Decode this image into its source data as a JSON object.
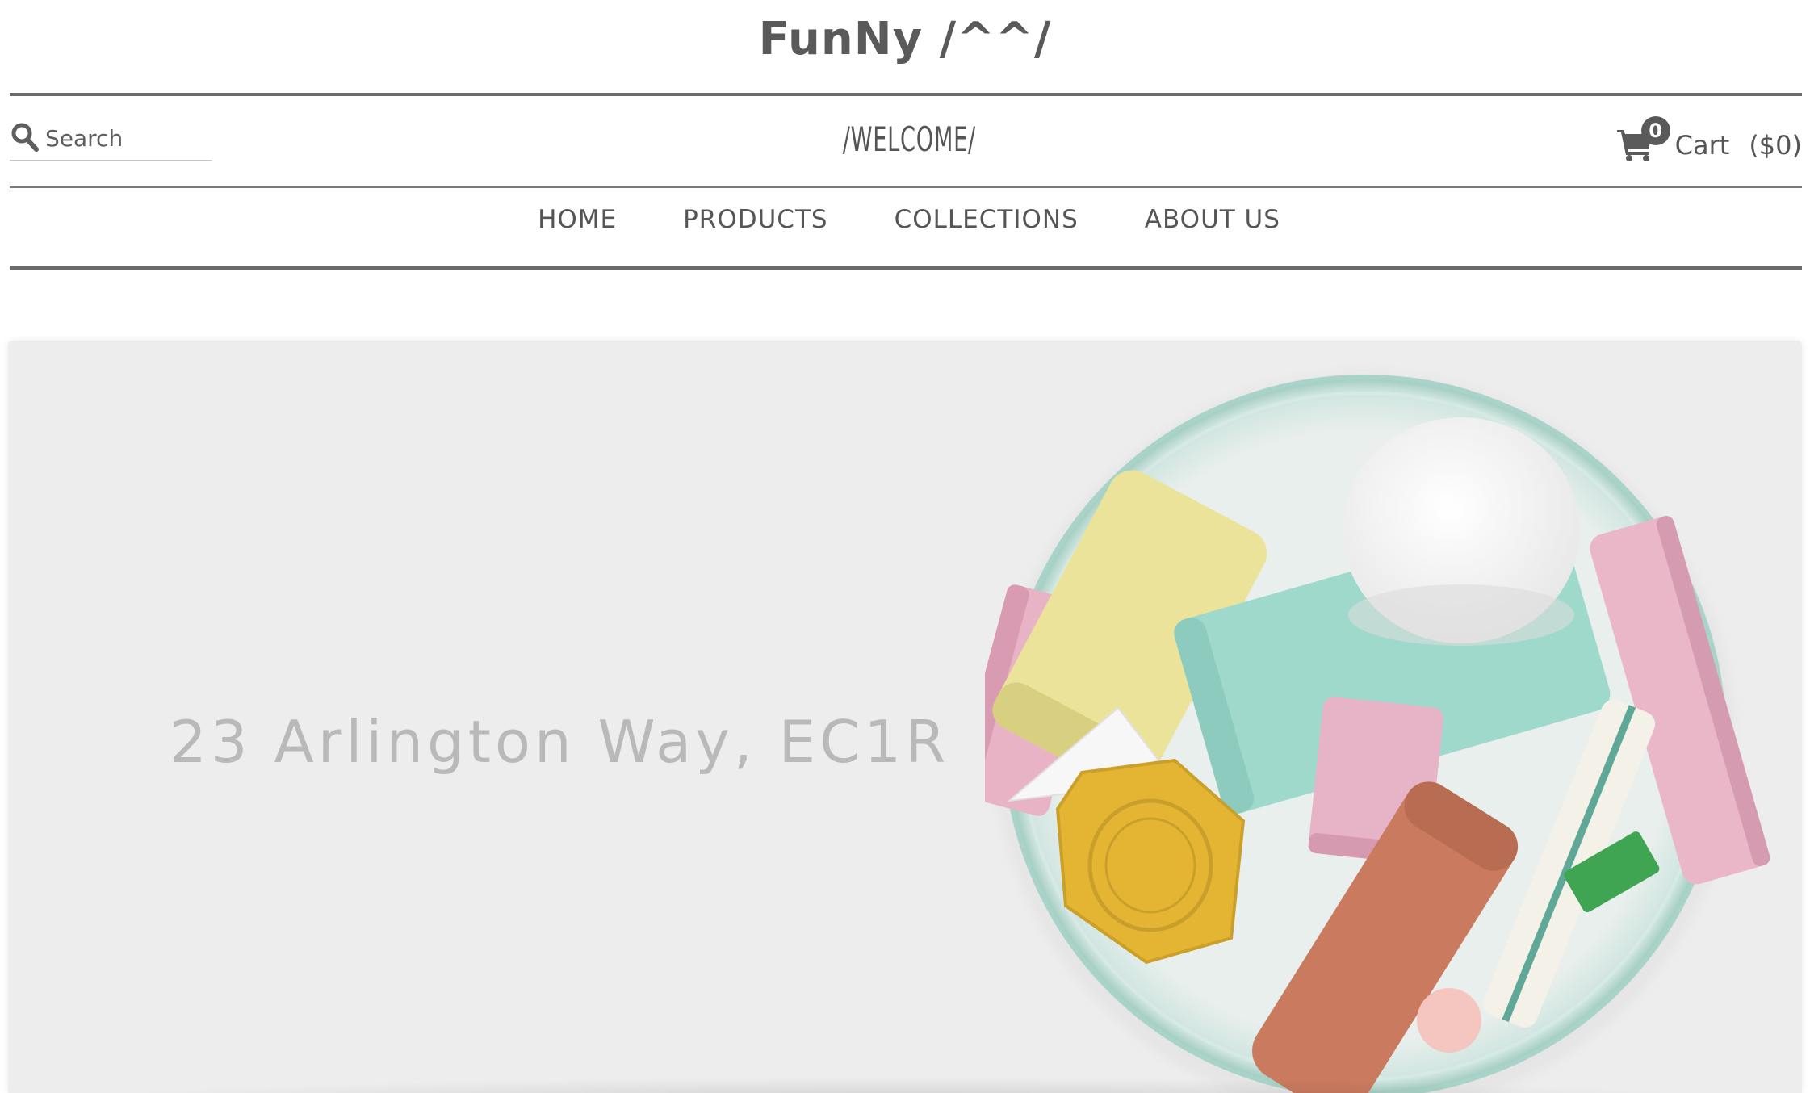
{
  "header": {
    "site_title": "FunNy /^^/",
    "welcome": "/WELCOME/"
  },
  "search": {
    "placeholder": "Search",
    "icon": "search-icon"
  },
  "cart": {
    "icon": "cart-icon",
    "count": "0",
    "label": "Cart",
    "total": "($0)"
  },
  "nav": {
    "items": [
      {
        "label": "HOME"
      },
      {
        "label": "PRODUCTS"
      },
      {
        "label": "COLLECTIONS"
      },
      {
        "label": "ABOUT US"
      }
    ]
  },
  "hero": {
    "address": "23 Arlington Way, EC1R",
    "image": "bowl-of-erasers-photo"
  },
  "colors": {
    "text": "#5e5e5e",
    "hero_bg": "#ededed",
    "address_text": "#b9b9b9"
  }
}
